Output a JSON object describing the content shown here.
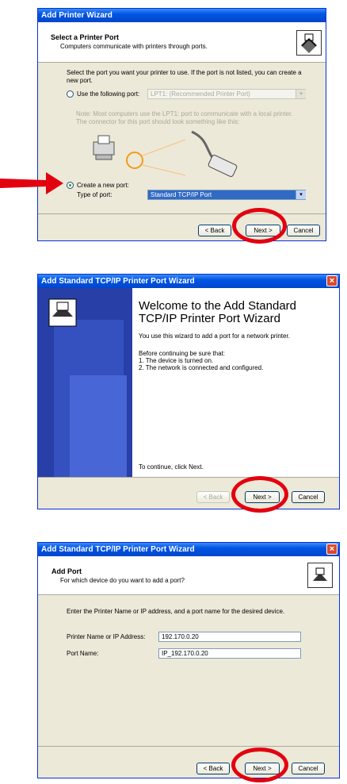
{
  "w1": {
    "title": "Add Printer Wizard",
    "header_title": "Select a Printer Port",
    "header_sub": "Computers communicate with printers through ports.",
    "intro_line1": "Select the port you want your printer to use.  If the port is not listed, you can create a",
    "intro_line2": "new port.",
    "use_following_label": "Use the following port:",
    "port_select_value": "LPT1: (Recommended Printer Port)",
    "note_line1": "Note: Most computers use the LPT1: port to communicate with a local printer.",
    "note_line2": "The connector for this port should look something like this:",
    "create_new_label": "Create a new port:",
    "type_of_port_label": "Type of port:",
    "type_of_port_value": "Standard TCP/IP Port",
    "back": "< Back",
    "next": "Next >",
    "cancel": "Cancel"
  },
  "w2": {
    "title": "Add Standard TCP/IP Printer Port Wizard",
    "close": "×",
    "heading_line1": "Welcome to the Add Standard",
    "heading_line2": "TCP/IP Printer Port Wizard",
    "desc": "You use this wizard to add a port for a network printer.",
    "before": "Before continuing be sure that:",
    "item1": "1.  The device is turned on.",
    "item2": "2.  The network is connected and configured.",
    "continue": "To continue, click Next.",
    "back": "< Back",
    "next": "Next >",
    "cancel": "Cancel"
  },
  "w3": {
    "title": "Add Standard TCP/IP Printer Port Wizard",
    "close": "×",
    "header_title": "Add Port",
    "header_sub": "For which device do you want to add a port?",
    "instruction": "Enter the Printer Name or IP address, and a port name for the desired device.",
    "ip_label": "Printer Name or IP Address:",
    "ip_value": "192.170.0.20",
    "port_label": "Port Name:",
    "port_value": "IP_192.170.0.20",
    "back": "< Back",
    "next": "Next >",
    "cancel": "Cancel"
  },
  "colors": {
    "highlight": "#e3000f",
    "title_blue": "#0054e3",
    "sidebar": "#283fa7",
    "select_blue": "#316ac5"
  },
  "icons": [
    "printer-icon",
    "dropdown-arrow-icon",
    "parallel-cable-icon",
    "close-icon",
    "red-arrow-icon"
  ]
}
